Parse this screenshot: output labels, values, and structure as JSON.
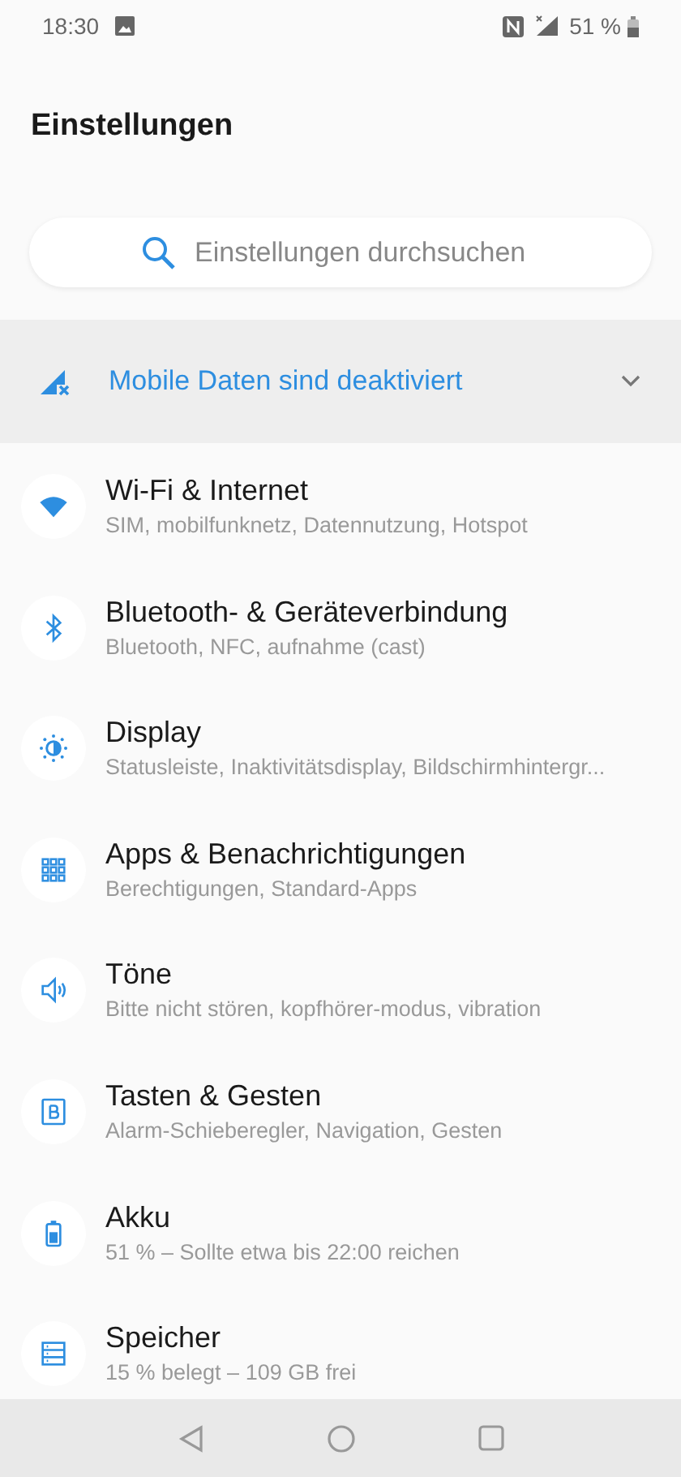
{
  "status_bar": {
    "time": "18:30",
    "battery": "51 %"
  },
  "title": "Einstellungen",
  "search": {
    "placeholder": "Einstellungen durchsuchen"
  },
  "banner": {
    "text": "Mobile Daten sind deaktiviert",
    "expanded": false
  },
  "items": [
    {
      "title": "Wi-Fi & Internet",
      "subtitle": "SIM, mobilfunknetz, Datennutzung, Hotspot"
    },
    {
      "title": "Bluetooth- & Geräteverbindung",
      "subtitle": "Bluetooth, NFC, aufnahme (cast)"
    },
    {
      "title": "Display",
      "subtitle": "Statusleiste, Inaktivitätsdisplay, Bildschirmhintergr..."
    },
    {
      "title": "Apps & Benachrichtigungen",
      "subtitle": "Berechtigungen, Standard-Apps"
    },
    {
      "title": "Töne",
      "subtitle": "Bitte nicht stören, kopfhörer-modus, vibration"
    },
    {
      "title": "Tasten & Gesten",
      "subtitle": "Alarm-Schieberegler, Navigation, Gesten"
    },
    {
      "title": "Akku",
      "subtitle": "51 % – Sollte etwa bis 22:00 reichen"
    },
    {
      "title": "Speicher",
      "subtitle": "15 % belegt – 109 GB frei"
    }
  ]
}
